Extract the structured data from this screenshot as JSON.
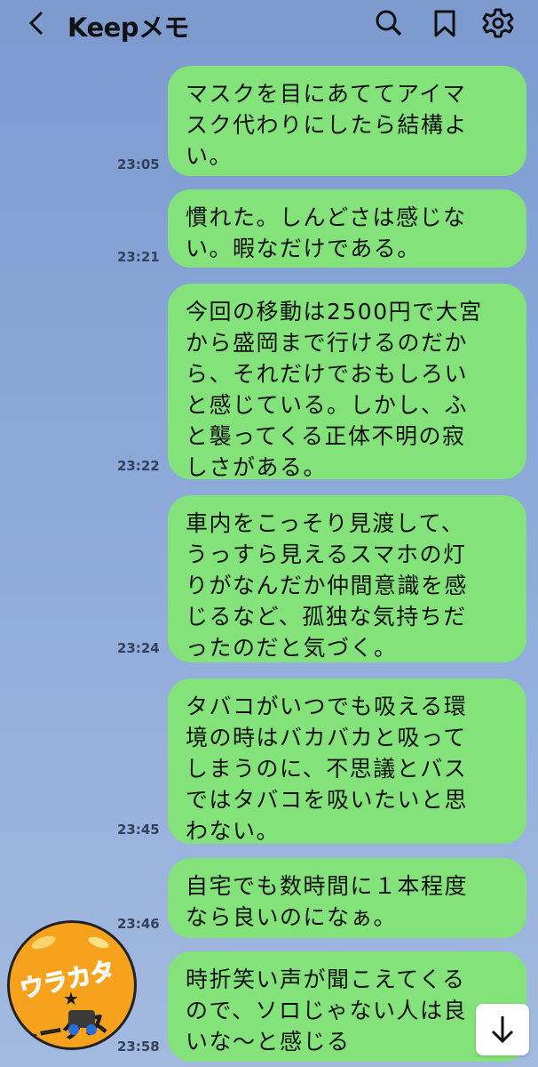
{
  "header": {
    "title": "Keepメモ",
    "back_icon": "chevron-left-icon",
    "search_icon": "search-icon",
    "bookmark_icon": "bookmark-icon",
    "settings_icon": "gear-icon"
  },
  "messages": [
    {
      "text": "マスクを目にあててアイマ\nスク代わりにしたら結構よ\nい。",
      "time": "23:05"
    },
    {
      "text": "慣れた。しんどさは感じな\nい。暇なだけである。",
      "time": "23:21"
    },
    {
      "text": "今回の移動は2500円で大宮\nから盛岡まで行けるのだか\nら、それだけでおもしろい\nと感じている。しかし、ふ\nと襲ってくる正体不明の寂\nしさがある。",
      "time": "23:22"
    },
    {
      "text": "車内をこっそり見渡して、\nうっすら見えるスマホの灯\nりがなんだか仲間意識を感\nじるなど、孤独な気持ちだ\nったのだと気づく。",
      "time": "23:24"
    },
    {
      "text": "タバコがいつでも吸える環\n境の時はバカバカと吸って\nしまうのに、不思議とバス\nではタバコを吸いたいと思\nわない。",
      "time": "23:45"
    },
    {
      "text": "自宅でも数時間に１本程度\nなら良いのになぁ。",
      "time": "23:46"
    },
    {
      "text": "時折笑い声が聞こえてくる\nので、ソロじゃない人は良\nいな〜と感じる",
      "time": "23:58"
    }
  ],
  "logo": {
    "line1": "ウラカタ",
    "star": "★",
    "line2": "トークス"
  },
  "scroll_down_icon": "arrow-down-icon",
  "colors": {
    "bubble": "#84e27a",
    "background": "#89a6d8",
    "logo": "#f6a21d"
  }
}
